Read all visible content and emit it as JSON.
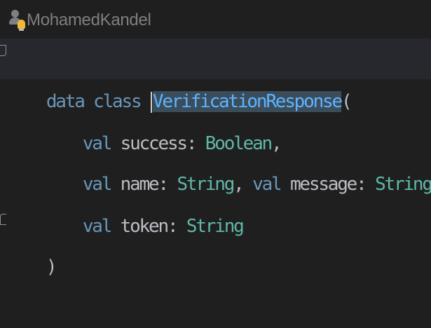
{
  "author": {
    "name": "MohamedKandel"
  },
  "code": {
    "line1": {
      "kw_data": "data",
      "kw_class": "class",
      "class_name": "VerificationResponse",
      "open_paren": "("
    },
    "line2": {
      "kw_val": "val",
      "name": "success",
      "colon": ":",
      "type": "Boolean",
      "comma": ","
    },
    "line3": {
      "kw_val_1": "val",
      "name_1": "name",
      "colon_1": ":",
      "type_1": "String",
      "comma_1": ",",
      "kw_val_2": "val",
      "name_2": "message",
      "colon_2": ":",
      "type_2": "String",
      "comma_2": ","
    },
    "line4": {
      "kw_val": "val",
      "name": "token",
      "colon": ":",
      "type": "String"
    },
    "line5": {
      "close_paren": ")"
    }
  },
  "colors": {
    "background": "#1f1f1f",
    "keyword_data_class": "#cf8e6d",
    "keyword_val": "#6897bb",
    "type": "#5fb8a8",
    "class_name": "#5eb3ff",
    "identifier": "#bcbec4"
  },
  "icons": {
    "author": "author-icon",
    "fold": "fold-icon"
  }
}
